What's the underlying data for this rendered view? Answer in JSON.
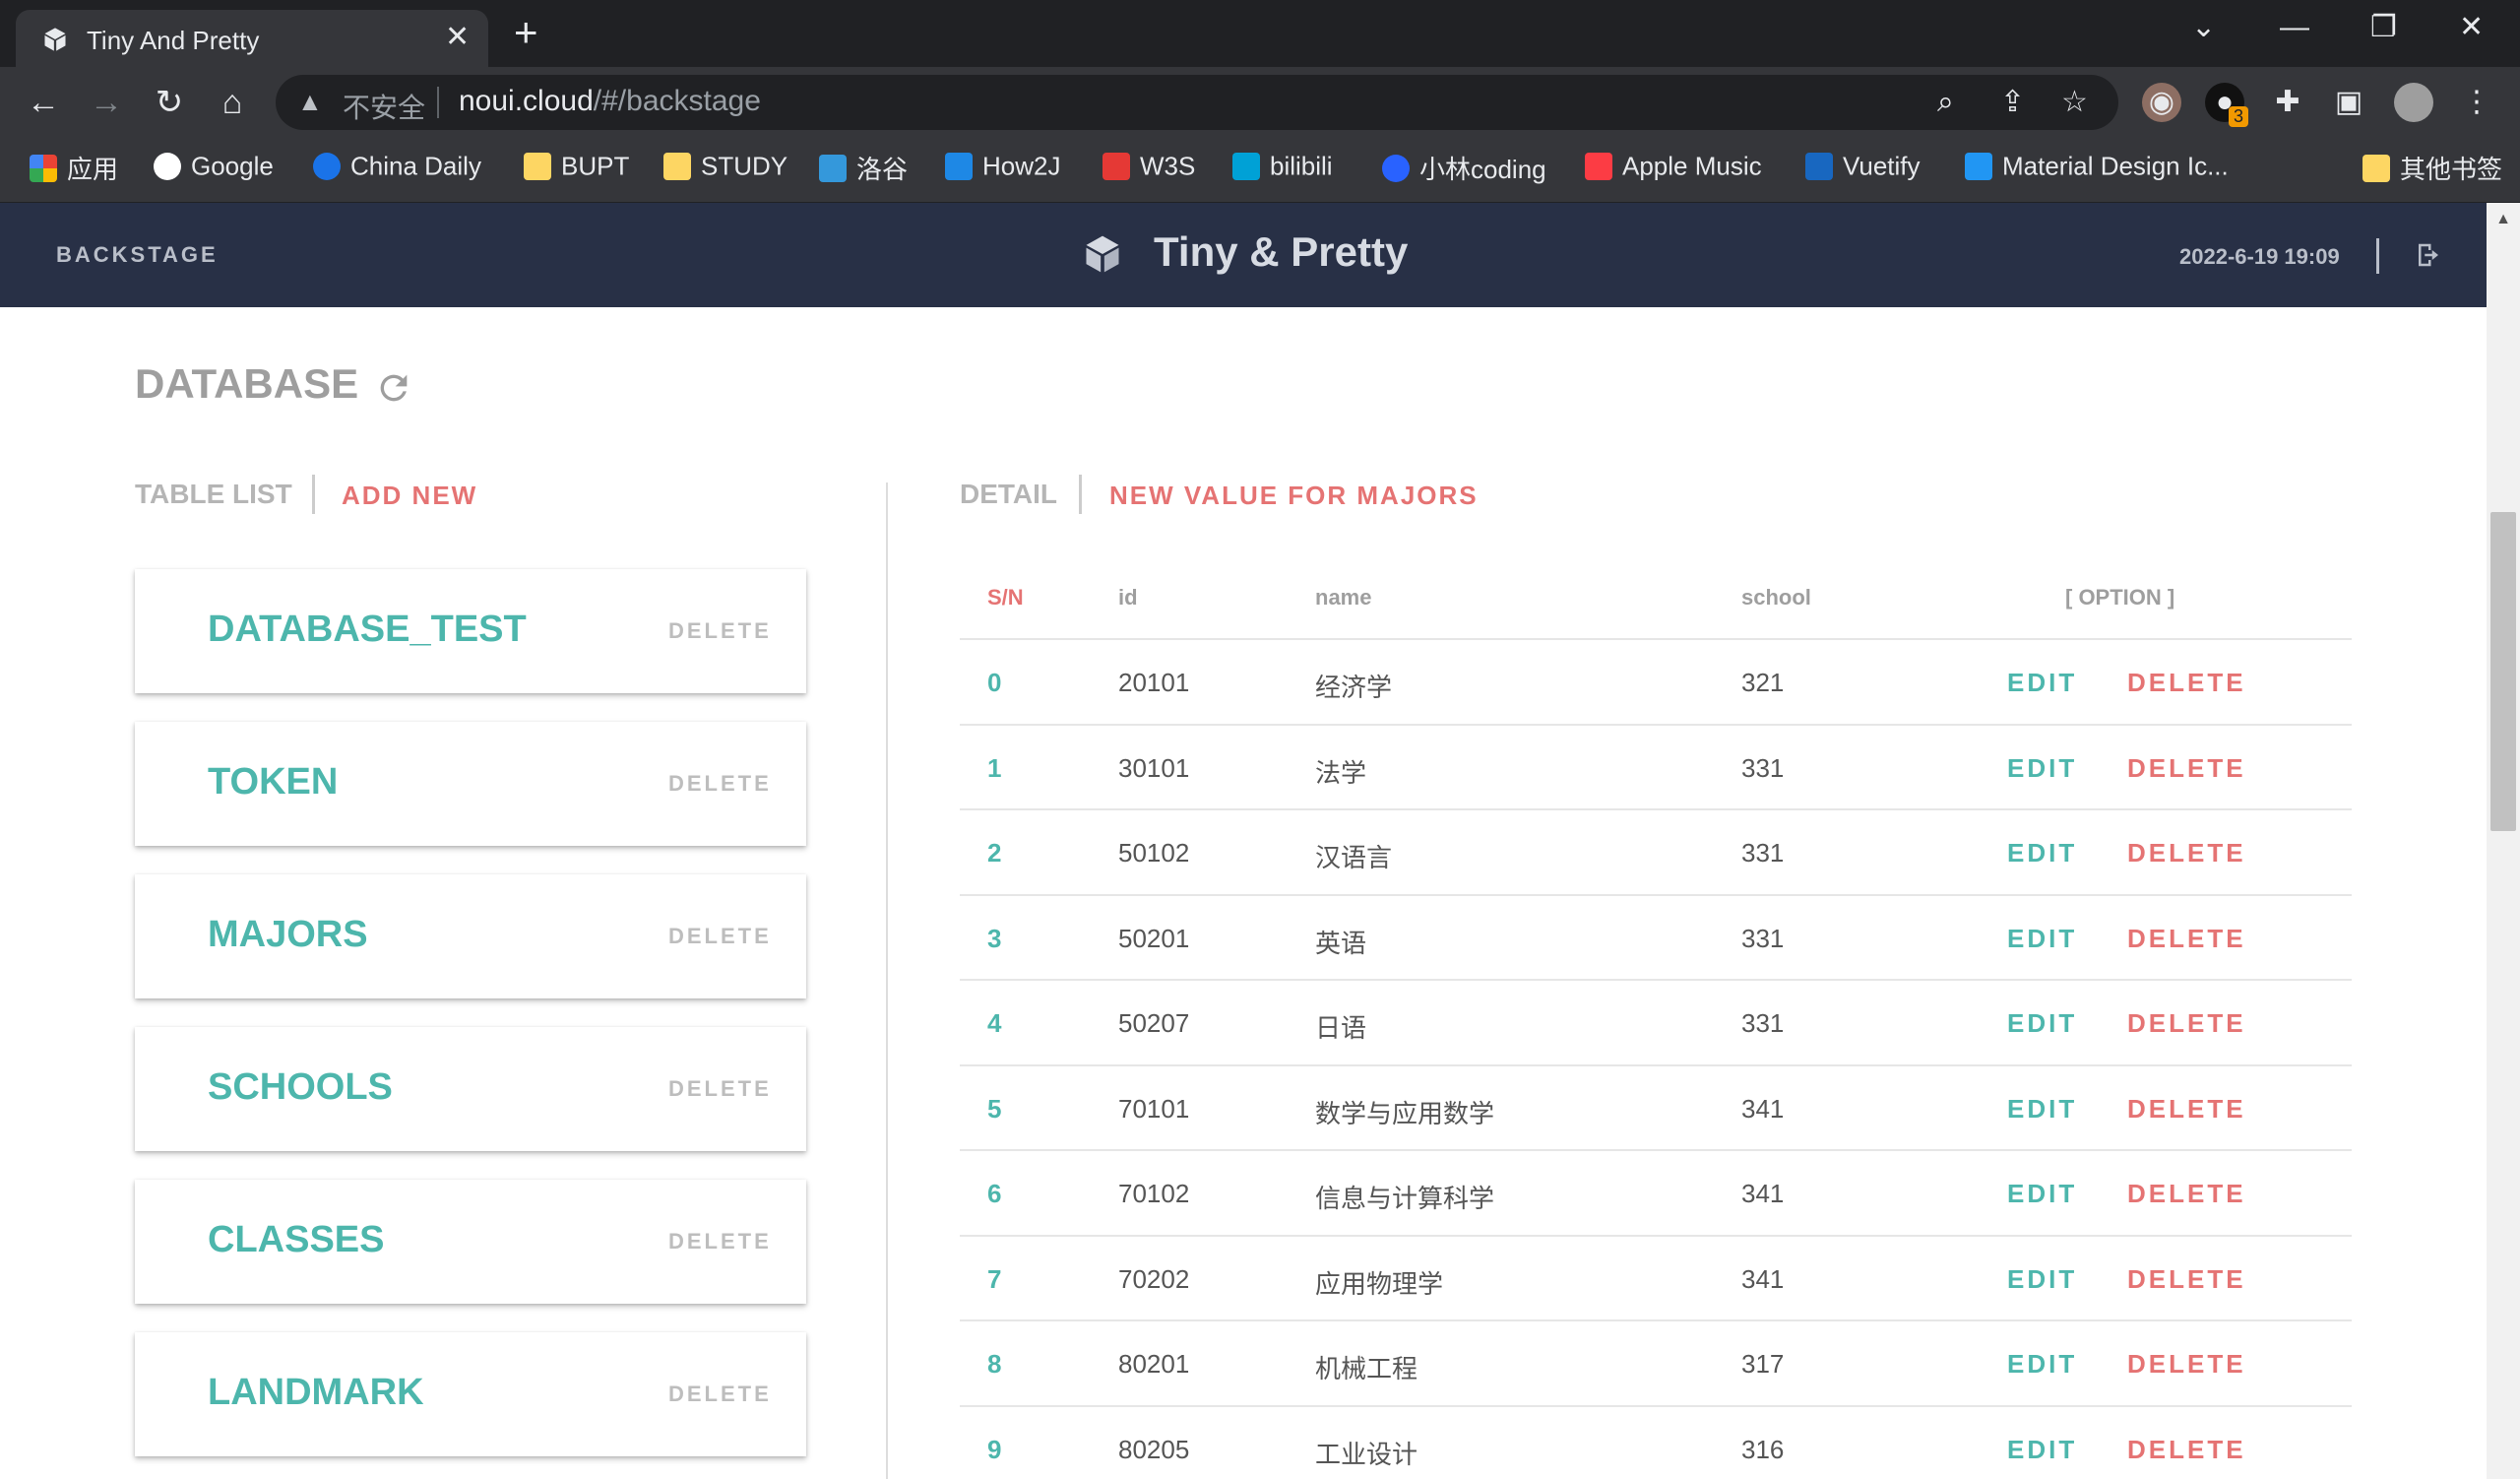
{
  "browser": {
    "tab_title": "Tiny And Pretty",
    "insecure_label": "不安全",
    "url_host": "noui.cloud",
    "url_path": "/#/backstage",
    "ext_badge": "3",
    "bookmarks": [
      {
        "label": "应用",
        "color": "#ea4335"
      },
      {
        "label": "Google",
        "color": "#ffffff"
      },
      {
        "label": "China Daily",
        "color": "#1a73e8"
      },
      {
        "label": "BUPT",
        "color": "#fdd663"
      },
      {
        "label": "STUDY",
        "color": "#fdd663"
      },
      {
        "label": "洛谷",
        "color": "#3498db"
      },
      {
        "label": "How2J",
        "color": "#1e88e5"
      },
      {
        "label": "W3S",
        "color": "#e53935"
      },
      {
        "label": "bilibili",
        "color": "#00a1d6"
      },
      {
        "label": "小林coding",
        "color": "#2962ff"
      },
      {
        "label": "Apple Music",
        "color": "#fc3c44"
      },
      {
        "label": "Vuetify",
        "color": "#1867c0"
      },
      {
        "label": "Material Design Ic...",
        "color": "#2196f3"
      },
      {
        "label": "其他书签",
        "color": "#fdd663"
      }
    ]
  },
  "header": {
    "left_label": "BACKSTAGE",
    "title": "Tiny & Pretty",
    "datetime": "2022-6-19 19:09"
  },
  "main": {
    "section_title": "DATABASE",
    "left_tabs": {
      "list": "TABLE LIST",
      "add": "ADD NEW"
    },
    "delete_label": "DELETE",
    "tables": [
      "DATABASE_TEST",
      "TOKEN",
      "MAJORS",
      "SCHOOLS",
      "CLASSES",
      "LANDMARK"
    ],
    "right_tabs": {
      "detail": "DETAIL",
      "new_value": "NEW VALUE FOR MAJORS"
    },
    "columns": {
      "sn": "S/N",
      "id": "id",
      "name": "name",
      "school": "school",
      "option": "[ OPTION ]"
    },
    "edit_label": "EDIT",
    "rows": [
      {
        "sn": "0",
        "id": "20101",
        "name": "经济学",
        "school": "321"
      },
      {
        "sn": "1",
        "id": "30101",
        "name": "法学",
        "school": "331"
      },
      {
        "sn": "2",
        "id": "50102",
        "name": "汉语言",
        "school": "331"
      },
      {
        "sn": "3",
        "id": "50201",
        "name": "英语",
        "school": "331"
      },
      {
        "sn": "4",
        "id": "50207",
        "name": "日语",
        "school": "331"
      },
      {
        "sn": "5",
        "id": "70101",
        "name": "数学与应用数学",
        "school": "341"
      },
      {
        "sn": "6",
        "id": "70102",
        "name": "信息与计算科学",
        "school": "341"
      },
      {
        "sn": "7",
        "id": "70202",
        "name": "应用物理学",
        "school": "341"
      },
      {
        "sn": "8",
        "id": "80201",
        "name": "机械工程",
        "school": "317"
      },
      {
        "sn": "9",
        "id": "80205",
        "name": "工业设计",
        "school": "316"
      }
    ]
  },
  "colors": {
    "accent": "#4db6ac",
    "danger": "#e57373",
    "header_bg": "#283046"
  }
}
